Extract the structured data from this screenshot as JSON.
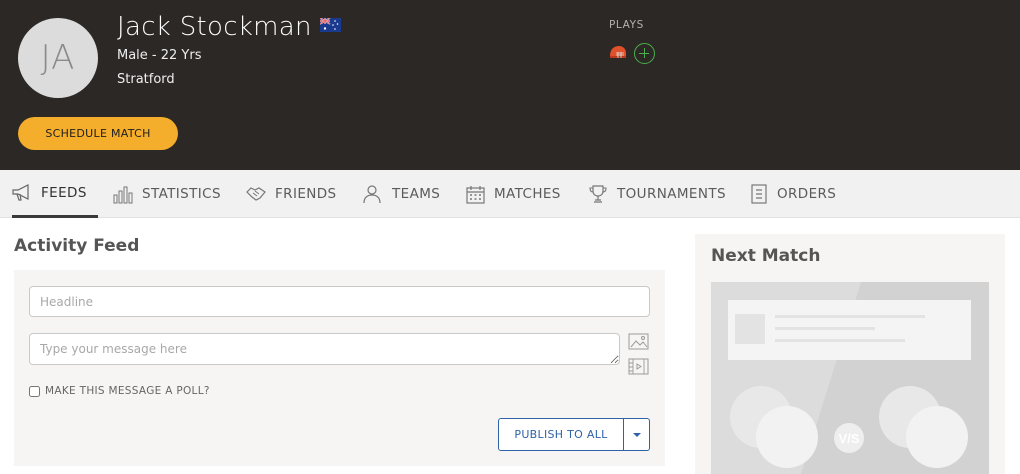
{
  "profile": {
    "initials": "JA",
    "name": "Jack Stockman",
    "country_flag": "australia-flag-icon",
    "gender_age": "Male - 22 Yrs",
    "location": "Stratford",
    "plays_label": "PLAYS",
    "sports_icons": [
      "cricket-helmet-icon",
      "add-sport-icon"
    ],
    "schedule_button": "SCHEDULE MATCH"
  },
  "tabs": [
    {
      "label": "FEEDS",
      "icon": "megaphone-icon",
      "active": true
    },
    {
      "label": "STATISTICS",
      "icon": "bar-chart-icon"
    },
    {
      "label": "FRIENDS",
      "icon": "handshake-icon"
    },
    {
      "label": "TEAMS",
      "icon": "people-icon"
    },
    {
      "label": "MATCHES",
      "icon": "calendar-icon"
    },
    {
      "label": "TOURNAMENTS",
      "icon": "trophy-icon"
    },
    {
      "label": "ORDERS",
      "icon": "receipt-icon"
    }
  ],
  "feed": {
    "title": "Activity Feed",
    "headline_placeholder": "Headline",
    "message_placeholder": "Type your message here",
    "poll_label": "MAKE THIS MESSAGE A POLL?",
    "publish_label": "PUBLISH TO ALL"
  },
  "next_match": {
    "title": "Next Match",
    "vs_label": "V/S"
  },
  "colors": {
    "header_bg": "#2c2826",
    "accent_yellow": "#f5ad2c",
    "publish_blue": "#2f63a8",
    "add_green": "#4cae4c"
  }
}
